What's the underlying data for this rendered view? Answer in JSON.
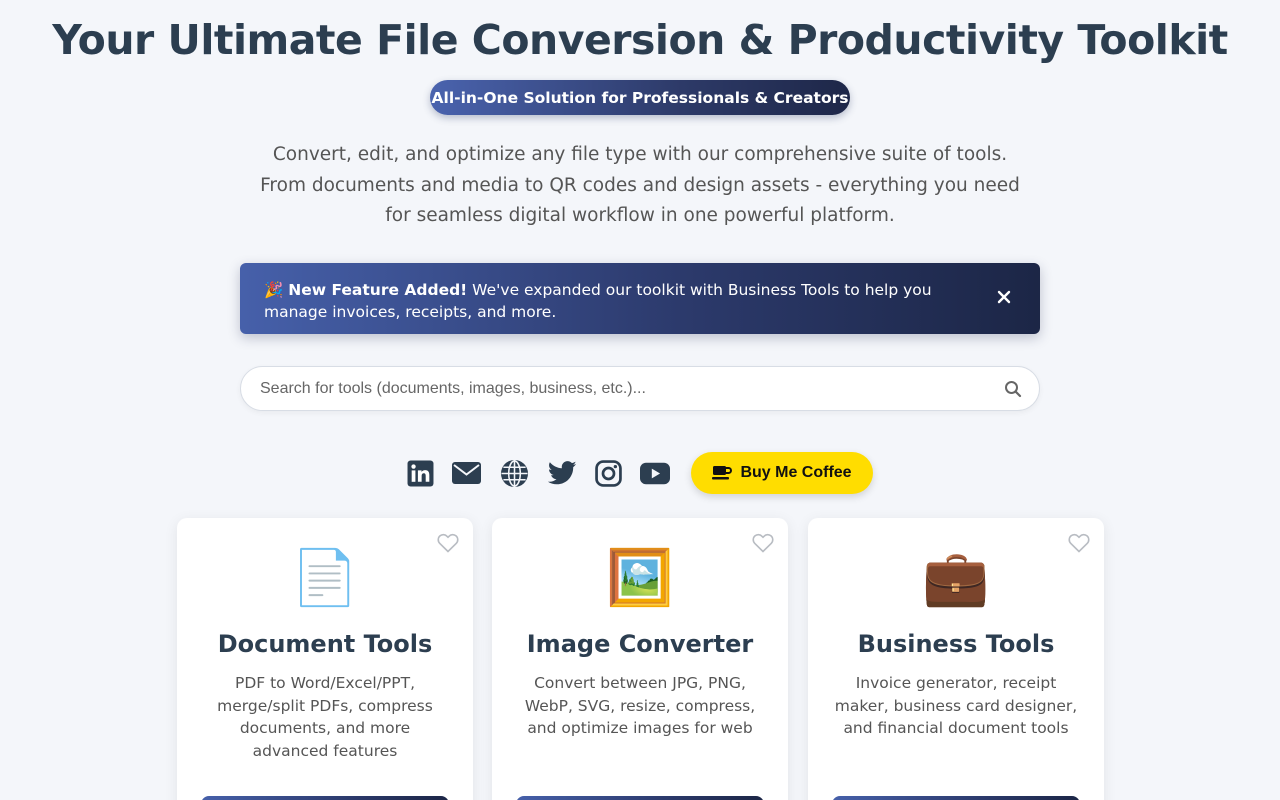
{
  "header": {
    "title": "Your Ultimate File Conversion & Productivity Toolkit",
    "subtitle": "All-in-One Solution for Professionals & Creators",
    "description": "Convert, edit, and optimize any file type with our comprehensive suite of tools. From documents and media to QR codes and design assets - everything you need for seamless digital workflow in one powerful platform."
  },
  "banner": {
    "emoji": "🎉",
    "strong": "New Feature Added!",
    "text": " We've expanded our toolkit with Business Tools to help you manage invoices, receipts, and more.",
    "close_icon": "close-icon"
  },
  "search": {
    "placeholder": "Search for tools (documents, images, business, etc.)...",
    "value": ""
  },
  "socials": {
    "icons": [
      "linkedin-icon",
      "email-icon",
      "globe-icon",
      "twitter-icon",
      "instagram-icon",
      "youtube-icon"
    ],
    "coffee_label": "Buy Me Coffee",
    "coffee_color": "#ffdd00"
  },
  "cards": [
    {
      "icon": "📄",
      "title": "Document Tools",
      "description": "PDF to Word/Excel/PPT, merge/split PDFs, compress documents, and more advanced features"
    },
    {
      "icon": "🖼️",
      "title": "Image Converter",
      "description": "Convert between JPG, PNG, WebP, SVG, resize, compress, and optimize images for web"
    },
    {
      "icon": "💼",
      "title": "Business Tools",
      "description": "Invoice generator, receipt maker, business card designer, and financial document tools"
    }
  ],
  "colors": {
    "primary": "#2c3e50",
    "accent_gradient_start": "#4660aa",
    "accent_gradient_end": "#1c2646",
    "background": "#f4f6fa"
  }
}
